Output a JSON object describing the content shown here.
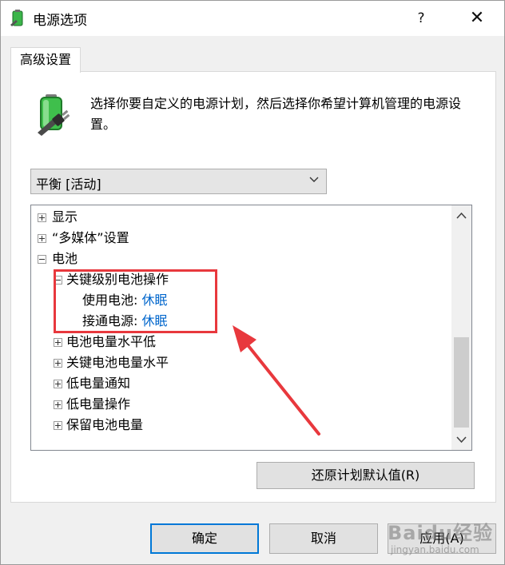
{
  "window": {
    "title": "电源选项",
    "help_glyph": "?",
    "close_glyph": "✕"
  },
  "tab": {
    "label": "高级设置"
  },
  "description": "选择你要自定义的电源计划，然后选择你希望计算机管理的电源设置。",
  "plan_select": {
    "value": "平衡 [活动]"
  },
  "tree": {
    "items": [
      {
        "label": "显示",
        "expander": "plus"
      },
      {
        "label": "“多媒体”设置",
        "expander": "plus"
      },
      {
        "label": "电池",
        "expander": "minus"
      },
      {
        "label": "关键级别电池操作",
        "expander": "minus"
      },
      {
        "label": "使用电池:",
        "value": "休眠"
      },
      {
        "label": "接通电源:",
        "value": "休眠"
      },
      {
        "label": "电池电量水平低",
        "expander": "plus"
      },
      {
        "label": "关键电池电量水平",
        "expander": "plus"
      },
      {
        "label": "低电量通知",
        "expander": "plus"
      },
      {
        "label": "低电量操作",
        "expander": "plus"
      },
      {
        "label": "保留电池电量",
        "expander": "plus"
      }
    ]
  },
  "buttons": {
    "restore": "还原计划默认值(R)",
    "ok": "确定",
    "cancel": "取消",
    "apply": "应用(A)"
  },
  "watermark": {
    "brand": "Baidu经验",
    "url": "jingyan.baidu.com"
  },
  "colors": {
    "link": "#0066cc",
    "annotation": "#e8383d",
    "focus": "#0078d7"
  }
}
